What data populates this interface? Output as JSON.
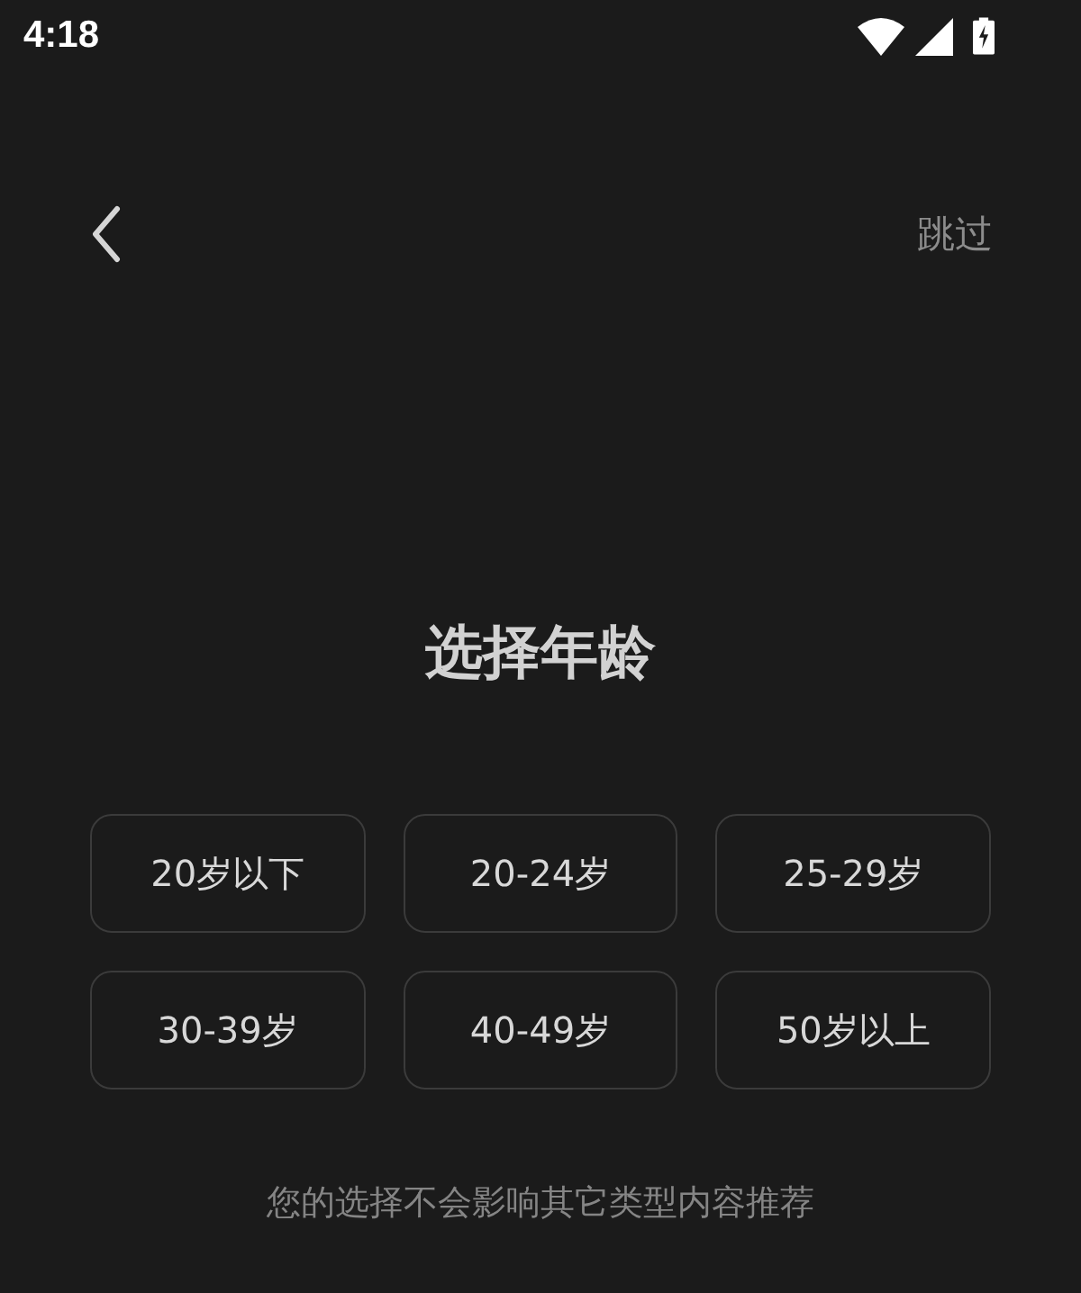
{
  "status_bar": {
    "time": "4:18"
  },
  "nav": {
    "skip": "跳过"
  },
  "title": "选择年龄",
  "options": [
    {
      "label": "20岁以下",
      "selected": false
    },
    {
      "label": "20-24岁",
      "selected": false
    },
    {
      "label": "25-29岁",
      "selected": false
    },
    {
      "label": "30-39岁",
      "selected": false
    },
    {
      "label": "40-49岁",
      "selected": false
    },
    {
      "label": "50岁以上",
      "selected": false
    }
  ],
  "footer_note": "您的选择不会影响其它类型内容推荐"
}
